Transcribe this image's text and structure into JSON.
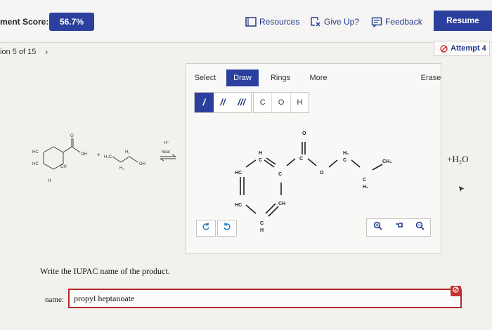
{
  "header": {
    "score_label": "ment Score:",
    "score_value": "56.7%",
    "resources_label": "Resources",
    "giveup_label": "Give Up?",
    "feedback_label": "Feedback",
    "resume_label": "Resume"
  },
  "nav": {
    "question_counter": "ion 5 of 15",
    "next_glyph": "›",
    "attempt_label": "Attempt 4"
  },
  "editor": {
    "tabs": [
      {
        "label": "Select"
      },
      {
        "label": "Draw"
      },
      {
        "label": "Rings"
      },
      {
        "label": "More"
      },
      {
        "label": "Erase"
      }
    ],
    "bonds": [
      "/",
      "//",
      "///"
    ],
    "atoms": [
      "C",
      "O",
      "H"
    ]
  },
  "reaction": {
    "conditions_top": "H⁺",
    "conditions_bottom": "heat",
    "plus": "+",
    "byproduct": "+H₂O"
  },
  "question": {
    "prompt": "Write the IUPAC name of the product.",
    "name_label": "name:",
    "answer_value": "propyl heptanoate"
  },
  "colors": {
    "accent": "#2b3f9e",
    "error": "#c43030"
  }
}
